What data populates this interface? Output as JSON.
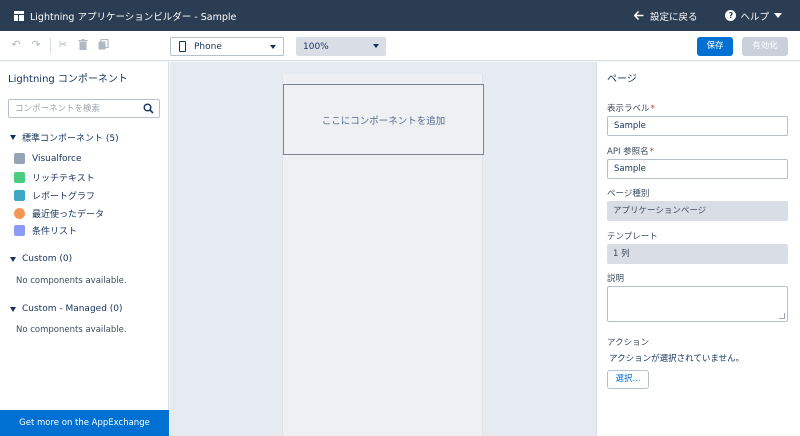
{
  "header": {
    "title": "Lightning アプリケーションビルダー - Sample",
    "back_label": "設定に戻る",
    "help_label": "ヘルプ"
  },
  "toolbar": {
    "device": "Phone",
    "zoom": "100%",
    "save_label": "保存",
    "activate_label": "有効化"
  },
  "left_panel": {
    "title": "Lightning コンポーネント",
    "search_placeholder": "コンポーネントを検索",
    "standard": {
      "heading": "標準コンポーネント (5)",
      "items": [
        {
          "label": "Visualforce",
          "icon": "visualforce-icon",
          "color": "#97a4b7"
        },
        {
          "label": "リッチテキスト",
          "icon": "rich-text-icon",
          "color": "#4bca81"
        },
        {
          "label": "レポートグラフ",
          "icon": "report-chart-icon",
          "color": "#3ba6c6"
        },
        {
          "label": "最近使ったデータ",
          "icon": "recent-items-icon",
          "color": "#f49756"
        },
        {
          "label": "条件リスト",
          "icon": "list-view-icon",
          "color": "#8d9bf8"
        }
      ]
    },
    "custom": {
      "heading": "Custom (0)",
      "empty": "No components available."
    },
    "custom_managed": {
      "heading": "Custom - Managed (0)",
      "empty": "No components available."
    },
    "appexchange_label": "Get more on the AppExchange"
  },
  "canvas": {
    "drop_zone_label": "ここにコンポーネントを追加"
  },
  "right_panel": {
    "title": "ページ",
    "label_field": {
      "label": "表示ラベル",
      "value": "Sample"
    },
    "api_field": {
      "label": "API 参照名",
      "value": "Sample"
    },
    "page_type": {
      "label": "ページ種別",
      "value": "アプリケーションページ"
    },
    "template": {
      "label": "テンプレート",
      "value": "1 列"
    },
    "description": {
      "label": "説明"
    },
    "actions": {
      "label": "アクション",
      "none_text": "アクションが選択されていません。",
      "select_label": "選択..."
    }
  }
}
